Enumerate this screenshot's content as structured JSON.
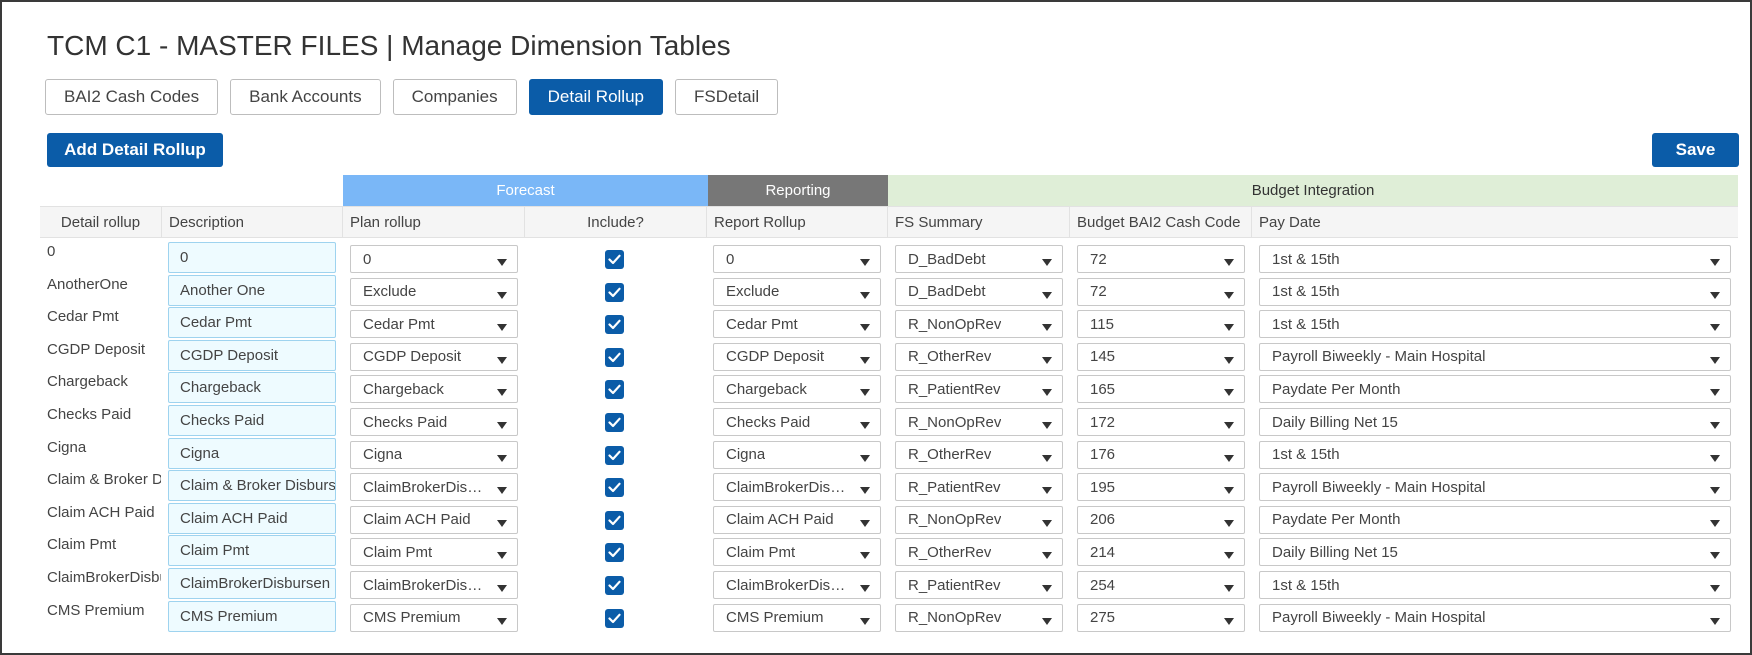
{
  "page": {
    "title": "TCM C1 - MASTER FILES | Manage Dimension Tables"
  },
  "tabs": [
    {
      "label": "BAI2 Cash Codes",
      "active": false
    },
    {
      "label": "Bank Accounts",
      "active": false
    },
    {
      "label": "Companies",
      "active": false
    },
    {
      "label": "Detail Rollup",
      "active": true
    },
    {
      "label": "FSDetail",
      "active": false
    }
  ],
  "actions": {
    "add_label": "Add Detail Rollup",
    "save_label": "Save"
  },
  "groups": {
    "forecast": "Forecast",
    "reporting": "Reporting",
    "budget": "Budget Integration"
  },
  "columns": {
    "detail_rollup": "Detail rollup",
    "description": "Description",
    "plan_rollup": "Plan rollup",
    "include": "Include?",
    "report_rollup": "Report Rollup",
    "fs_summary": "FS Summary",
    "budget_bai2": "Budget BAI2 Cash Code",
    "pay_date": "Pay Date"
  },
  "colors": {
    "primary": "#0b5ca8",
    "forecast": "#7ab7f7",
    "reporting": "#777777",
    "budget": "#dfeed7"
  },
  "rows": [
    {
      "detail": "0",
      "description": "0",
      "plan": "0",
      "include": true,
      "report": "0",
      "fs": "D_BadDebt",
      "bai2": "72",
      "pay": "1st & 15th"
    },
    {
      "detail": "AnotherOne",
      "description": "Another One",
      "plan": "Exclude",
      "include": true,
      "report": "Exclude",
      "fs": "D_BadDebt",
      "bai2": "72",
      "pay": "1st & 15th"
    },
    {
      "detail": "Cedar Pmt",
      "description": "Cedar Pmt",
      "plan": "Cedar Pmt",
      "include": true,
      "report": "Cedar Pmt",
      "fs": "R_NonOpRev",
      "bai2": "115",
      "pay": "1st & 15th"
    },
    {
      "detail": "CGDP Deposit",
      "description": "CGDP Deposit",
      "plan": "CGDP Deposit",
      "include": true,
      "report": "CGDP Deposit",
      "fs": "R_OtherRev",
      "bai2": "145",
      "pay": "Payroll Biweekly - Main Hospital"
    },
    {
      "detail": "Chargeback",
      "description": "Chargeback",
      "plan": "Chargeback",
      "include": true,
      "report": "Chargeback",
      "fs": "R_PatientRev",
      "bai2": "165",
      "pay": "Paydate Per Month"
    },
    {
      "detail": "Checks Paid",
      "description": "Checks Paid",
      "plan": "Checks Paid",
      "include": true,
      "report": "Checks Paid",
      "fs": "R_NonOpRev",
      "bai2": "172",
      "pay": "Daily Billing Net 15"
    },
    {
      "detail": "Cigna",
      "description": "Cigna",
      "plan": "Cigna",
      "include": true,
      "report": "Cigna",
      "fs": "R_OtherRev",
      "bai2": "176",
      "pay": "1st & 15th"
    },
    {
      "detail": "Claim & Broker Dis",
      "description": "Claim & Broker Disburs",
      "plan": "ClaimBrokerDisb...",
      "include": true,
      "report": "ClaimBrokerDisb...",
      "fs": "R_PatientRev",
      "bai2": "195",
      "pay": "Payroll Biweekly - Main Hospital"
    },
    {
      "detail": "Claim ACH Paid",
      "description": "Claim ACH Paid",
      "plan": "Claim ACH Paid",
      "include": true,
      "report": "Claim ACH Paid",
      "fs": "R_NonOpRev",
      "bai2": "206",
      "pay": "Paydate Per Month"
    },
    {
      "detail": "Claim Pmt",
      "description": "Claim Pmt",
      "plan": "Claim Pmt",
      "include": true,
      "report": "Claim Pmt",
      "fs": "R_OtherRev",
      "bai2": "214",
      "pay": "Daily Billing Net 15"
    },
    {
      "detail": "ClaimBrokerDisbu",
      "description": "ClaimBrokerDisbursen",
      "plan": "ClaimBrokerDisb...",
      "include": true,
      "report": "ClaimBrokerDisb...",
      "fs": "R_PatientRev",
      "bai2": "254",
      "pay": "1st & 15th"
    },
    {
      "detail": "CMS Premium",
      "description": "CMS Premium",
      "plan": "CMS Premium",
      "include": true,
      "report": "CMS Premium",
      "fs": "R_NonOpRev",
      "bai2": "275",
      "pay": "Payroll Biweekly - Main Hospital"
    }
  ]
}
